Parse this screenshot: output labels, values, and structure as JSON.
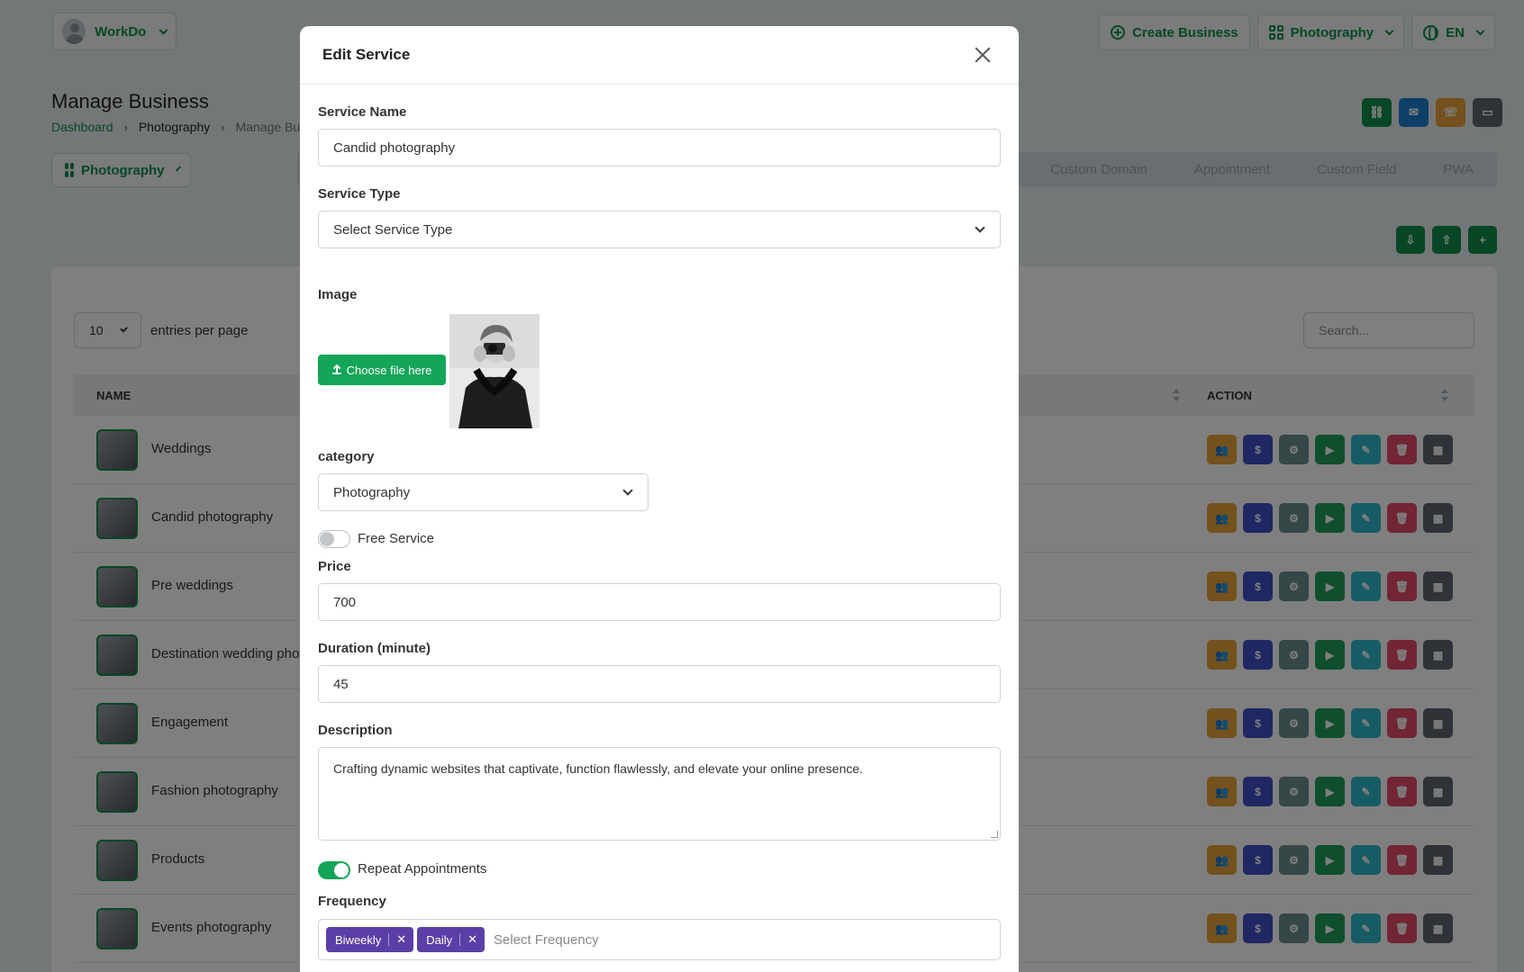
{
  "topbar": {
    "workspace": "WorkDo",
    "create_business": "Create Business",
    "business_select": "Photography",
    "language": "EN"
  },
  "page": {
    "title": "Manage Business",
    "breadcrumb": [
      "Dashboard",
      "Photography",
      "Manage Bus"
    ],
    "business_dropdown": "Photography",
    "tabs": [
      "Custom Domain",
      "Appointment",
      "Custom Field",
      "PWA"
    ]
  },
  "table": {
    "entries_value": "10",
    "entries_label": "entries per page",
    "search_placeholder": "Search...",
    "col_name": "NAME",
    "col_action": "ACTION",
    "rows": [
      "Weddings",
      "Candid photography",
      "Pre weddings",
      "Destination wedding phot",
      "Engagement",
      "Fashion photography",
      "Products",
      "Events photography"
    ]
  },
  "modal": {
    "title": "Edit Service",
    "service_name_label": "Service Name",
    "service_name_value": "Candid photography",
    "service_type_label": "Service Type",
    "service_type_value": "Select Service Type",
    "image_label": "Image",
    "upload_label": "Choose file here",
    "category_label": "category",
    "category_value": "Photography",
    "free_service_label": "Free Service",
    "free_service_on": false,
    "price_label": "Price",
    "price_value": "700",
    "duration_label": "Duration (minute)",
    "duration_value": "45",
    "description_label": "Description",
    "description_value": "Crafting dynamic websites that captivate, function flawlessly, and elevate your online presence.",
    "repeat_label": "Repeat Appointments",
    "repeat_on": true,
    "frequency_label": "Frequency",
    "frequency_tags": [
      "Biweekly",
      "Daily"
    ],
    "frequency_placeholder": "Select Frequency"
  },
  "colors": {
    "brand_green": "#0f8f4a",
    "toggle_green": "#14a558",
    "tag_purple": "#5b3fa6",
    "action_buttons": [
      "#e8a33a",
      "#3f51c7",
      "#6a8f8f",
      "#1e9e5b",
      "#2eb8c8",
      "#e24a6a",
      "#5f6770"
    ]
  }
}
